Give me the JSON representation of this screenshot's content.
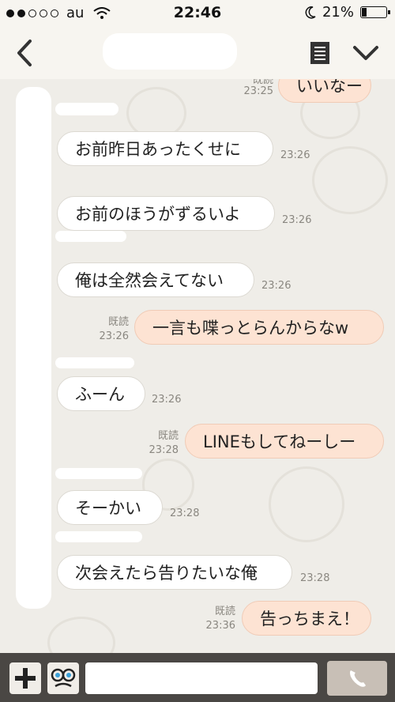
{
  "status_bar": {
    "carrier": "au",
    "time": "22:46",
    "battery": "21%",
    "battery_level": 0.21
  },
  "nav": {
    "back_icon": "chevron-left-icon",
    "menu_icon": "notes-icon",
    "expand_icon": "chevron-down-icon"
  },
  "messages": [
    {
      "side": "out",
      "text": "いいなー",
      "read": "既読",
      "time": "23:25"
    },
    {
      "side": "in",
      "text": "お前昨日あったくせに",
      "time": "23:26"
    },
    {
      "side": "in",
      "text": "お前のほうがずるいよ",
      "time": "23:26"
    },
    {
      "side": "in",
      "text": "俺は全然会えてない",
      "time": "23:26"
    },
    {
      "side": "out",
      "text": "一言も喋っとらんからなw",
      "read": "既読",
      "time": "23:26"
    },
    {
      "side": "in",
      "text": "ふーん",
      "time": "23:26"
    },
    {
      "side": "out",
      "text": "LINEもしてねーしー",
      "read": "既読",
      "time": "23:28"
    },
    {
      "side": "in",
      "text": "そーかい",
      "time": "23:28"
    },
    {
      "side": "in",
      "text": "次会えたら告りたいな俺",
      "time": "23:28"
    },
    {
      "side": "out",
      "text": "告っちまえ！",
      "read": "既読",
      "time": "23:36"
    }
  ],
  "input_bar": {
    "plus_icon": "plus-icon",
    "sticker_icon": "sticker-icon",
    "call_icon": "phone-icon",
    "message_value": ""
  },
  "colors": {
    "incoming_bubble": "#ffffff",
    "outgoing_bubble": "#fde3d3",
    "input_bar": "#4a4744"
  }
}
